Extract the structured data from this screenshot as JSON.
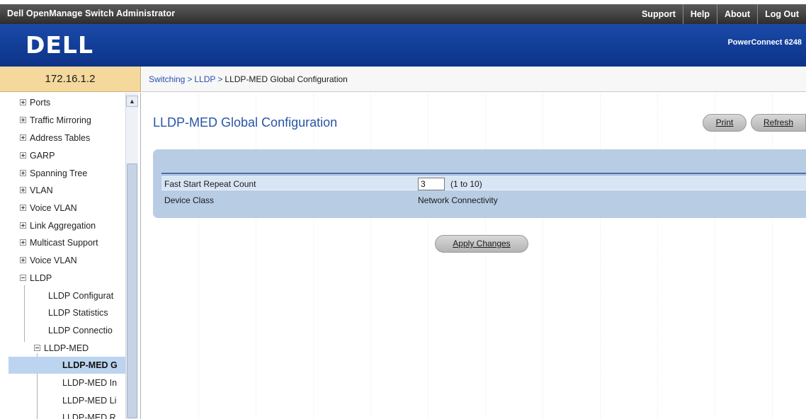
{
  "header": {
    "app_title": "Dell OpenManage Switch Administrator",
    "links": [
      "Support",
      "Help",
      "About",
      "Log Out"
    ]
  },
  "brand": {
    "logo": "DELL",
    "product": "PowerConnect 6248"
  },
  "ip": "172.16.1.2",
  "breadcrumb": {
    "items": [
      "Switching",
      "LLDP"
    ],
    "separator": ">",
    "current": "LLDP-MED Global Configuration"
  },
  "sidebar": {
    "items": [
      {
        "label": "Ports",
        "expander": "plus"
      },
      {
        "label": "Traffic Mirroring",
        "expander": "plus"
      },
      {
        "label": "Address Tables",
        "expander": "plus"
      },
      {
        "label": "GARP",
        "expander": "plus"
      },
      {
        "label": "Spanning Tree",
        "expander": "plus"
      },
      {
        "label": "VLAN",
        "expander": "plus"
      },
      {
        "label": "Voice VLAN",
        "expander": "plus"
      },
      {
        "label": "Link Aggregation",
        "expander": "plus"
      },
      {
        "label": "Multicast Support",
        "expander": "plus"
      },
      {
        "label": "Voice VLAN",
        "expander": "plus"
      },
      {
        "label": "LLDP",
        "expander": "minus"
      },
      {
        "label": "LLDP Configurat"
      },
      {
        "label": "LLDP Statistics"
      },
      {
        "label": "LLDP Connectio"
      },
      {
        "label": "LLDP-MED",
        "expander": "minus"
      },
      {
        "label": "LLDP-MED G",
        "selected": true
      },
      {
        "label": "LLDP-MED In"
      },
      {
        "label": "LLDP-MED Li"
      },
      {
        "label": "LLDP-MED R"
      }
    ]
  },
  "main": {
    "title": "LLDP-MED Global Configuration",
    "print_label": "Print",
    "refresh_label": "Refresh",
    "fields": {
      "fast_start": {
        "label": "Fast Start Repeat Count",
        "value": "3",
        "range": "(1 to 10)"
      },
      "device_class": {
        "label": "Device Class",
        "value": "Network Connectivity"
      }
    },
    "apply_label": "Apply Changes"
  }
}
